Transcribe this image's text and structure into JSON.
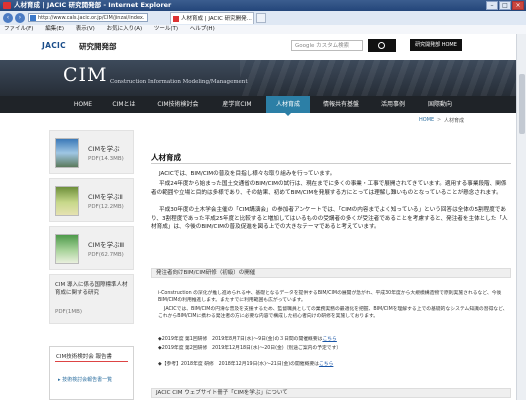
{
  "browser": {
    "title": "人材育成 | JACIC 研究開発部 - Internet Explorer",
    "address": "http://www.cals.jacic.or.jp/CIM/jinzai/index.",
    "tab_label": "人材育成 | JACIC 研究開発...",
    "menu": [
      "ファイル(F)",
      "編集(E)",
      "表示(V)",
      "お気に入り(A)",
      "ツール(T)",
      "ヘルプ(H)"
    ]
  },
  "header": {
    "logo": "JACIC",
    "dept": "研究開発部",
    "search_placeholder": "Google カスタム検索",
    "home_button": "研究開発部 HOME"
  },
  "hero": {
    "title": "CIM",
    "subtitle": "Construction Information Modeling/Management"
  },
  "nav": [
    "HOME",
    "CIMとは",
    "CIM技術検討会",
    "産学官CIM",
    "人材育成",
    "情報共有基盤",
    "活用事例",
    "国際動向"
  ],
  "nav_active_index": 4,
  "breadcrumb": {
    "home": "HOME",
    "sep": ">",
    "current": "人材育成"
  },
  "sidebar": {
    "cards": [
      {
        "title": "CIMを学ぶ",
        "pdf": "PDF(14.3MB)"
      },
      {
        "title": "CIMを学ぶⅡ",
        "pdf": "PDF(12.2MB)"
      },
      {
        "title": "CIMを学ぶⅢ",
        "pdf": "PDF(62.7MB)"
      },
      {
        "title": "CIM 導入に係る国際標準人材育成に関する研究",
        "pdf": "PDF(1MB)"
      }
    ],
    "box_title": "CIM技術検討会 報告書",
    "box_link": "技術検討会報告書一覧"
  },
  "main": {
    "title": "人材育成",
    "paragraphs": [
      "JACICでは、BIM/CIMの普及を目指し様々な取り組みを行っています。",
      "平成24年度から始まった国土交通省のBIM/CIMの試行は、現在までに多くの事業・工事で展開されてきています。適用する事業段階、関係者の範囲や立場と目的は多様であり、その結果、初めてBIM/CIMを発展する方にとっては理解し難いものとなっていることが懸念されます。",
      "平成30年度の土木学会主催の「CIM講演会」の参加者アンケートでは、「CIMの内容までよく知っている」という回答は全体の5割程度であり、3割程度であった平成25年度と比較すると増加してはいるものの受講者の多くが受注者であることを考慮すると、発注者を主体とした「人材育成」は、今後のBIM/CIMの普及促進を図る上での大きなテーマであると考えています。"
    ],
    "section1_title": "発注者向けBIM/CIM研修（初級）の開催",
    "notes": [
      "i-Construction の深化が推し進められる中、基礎となるデータを提供するBIM/CIMの展開が急がれ、平成30年度から大規模構造物で原則実施されるなど、今後BIM/CIMの利用推進します。またすでに利用範囲も広がっています。",
      "JACICでは、BIM/CIMの円滑な普及を支援するため、監督職員としての業務実務の最適化を把握、BIM/CIMを理解する上での基礎的なシステム知識の習得など、これからBIM/CIMに携わる発注者の方に必要な内容で構成した初心者向けの研修を実施しております。"
    ],
    "events": [
      {
        "text": "◆2019年度 第1回研修　2019年8月7日(水)〜9日(金)の３日間の開催概要は",
        "link": "こちら"
      },
      {
        "text": "◆2019年度 第2回研修　2019年12月18日(水)〜20日(金)（別途ご案内の予定です）",
        "link": ""
      },
      {
        "text": "◆【参考】2018年度 研修　2018年12月19日(水)〜21日(金)の開催概要は",
        "link": "こちら"
      }
    ],
    "section2_title": "JACIC CIM ウェブサイト冊子「CIMを学ぶ」について"
  },
  "colors": {
    "accent": "#2c7fa6",
    "nav_bg": "#1f2328",
    "link": "#1a56a8"
  }
}
